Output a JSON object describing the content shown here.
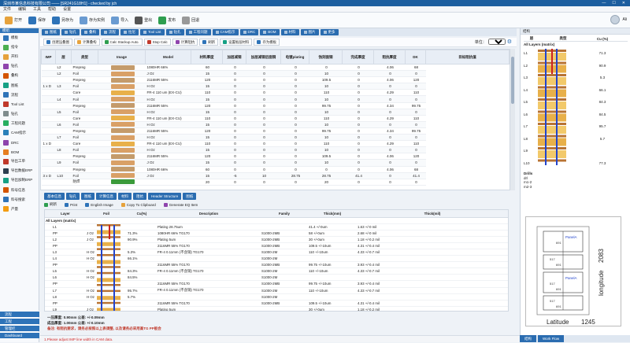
{
  "app": {
    "title": "深圳市某信息科技有限公司 —— [SR241G18H1] - checked by jch",
    "window_buttons": [
      "—",
      "☐",
      "✕"
    ],
    "user": "Ali"
  },
  "menu": [
    "文件",
    "编辑",
    "工具",
    "帮助",
    "设置"
  ],
  "toolbar": [
    {
      "label": "打开",
      "icon": "folder-icon",
      "color": "#e6a23c"
    },
    {
      "label": "保存",
      "icon": "save-icon",
      "color": "#2e73b8"
    },
    {
      "label": "另存为",
      "icon": "save-as-icon",
      "color": "#2e73b8"
    },
    {
      "label": "存为实例",
      "icon": "template-icon",
      "color": "#6a9bd1"
    },
    {
      "label": "导入",
      "icon": "import-icon",
      "color": "#6a9bd1"
    },
    {
      "label": "登出",
      "icon": "lock-icon",
      "color": "#555"
    },
    {
      "label": "发布",
      "icon": "publish-icon",
      "color": "#2e9e4f"
    },
    {
      "label": "回退",
      "icon": "undo-icon",
      "color": "#999"
    }
  ],
  "sidebar": {
    "header": "模组",
    "items": [
      {
        "label": "模板",
        "color": "#2e73b8"
      },
      {
        "label": "指令",
        "color": "#4caf50"
      },
      {
        "label": "开料",
        "color": "#e6a23c"
      },
      {
        "label": "钻孔",
        "color": "#8e44ad"
      },
      {
        "label": "叠构",
        "color": "#d35400"
      },
      {
        "label": "图纸",
        "color": "#16a085"
      },
      {
        "label": "流程",
        "color": "#2e73b8"
      },
      {
        "label": "Tool List",
        "color": "#c0392b"
      },
      {
        "label": "钻孔",
        "color": "#7f8c8d"
      },
      {
        "label": "工程问题",
        "color": "#27ae60"
      },
      {
        "label": "CAM指示",
        "color": "#2980b9"
      },
      {
        "label": "DRC",
        "color": "#8e44ad"
      },
      {
        "label": "BOM",
        "color": "#e67e22"
      },
      {
        "label": "导出工单",
        "color": "#c0392b"
      },
      {
        "label": "导出数据ERP",
        "color": "#2c3e50"
      },
      {
        "label": "导出加制ERP",
        "color": "#16a085"
      },
      {
        "label": "料号信息",
        "color": "#d35400"
      },
      {
        "label": "料号搜索",
        "color": "#2e73b8"
      },
      {
        "label": "产量",
        "color": "#f39c12"
      }
    ],
    "footer": [
      "流程",
      "工程",
      "管理栏",
      "Dashboard"
    ]
  },
  "tabs_top": [
    "图纸",
    "钻孔",
    "叠构",
    "流程",
    "拉尼",
    "Tool List",
    "钻孔",
    "工程问题",
    "CAM指示",
    "DRC",
    "BOM",
    "材料",
    "图片",
    "更多"
  ],
  "subtoolbar": {
    "buttons": [
      "创建压叠图",
      "计算叠构",
      "Calc Stackup Auto.",
      "Stop Calc",
      "计算阻抗",
      "刷新",
      "设置板层材料",
      "存为模板"
    ],
    "unit_label": "单位：",
    "unit_value": "Mil/OZ"
  },
  "stack_table": {
    "headers": [
      "IMP",
      "层",
      "类型",
      "Image",
      "Model",
      "材料厚度",
      "加层减铜",
      "加层减铜后面铜",
      "电镀plating",
      "蚀刻面铜",
      "完成厚度",
      "阻抗厚度",
      "DK",
      "目标阻抗值"
    ],
    "rows": [
      {
        "imp": "",
        "layer": "L2",
        "type": "Prepreg",
        "model": "1080HR 66%",
        "v": [
          "60",
          "0",
          "0",
          "0",
          "0",
          "0",
          "4.06",
          "68"
        ],
        "vc": "#c49b6b"
      },
      {
        "imp": "",
        "layer": "L2",
        "type": "Foil",
        "model": "J Oz",
        "v": [
          "15",
          "0",
          "0",
          "0",
          "10",
          "0",
          "0",
          "0"
        ],
        "vc": "#d9a066"
      },
      {
        "imp": "",
        "layer": "",
        "type": "Prepreg",
        "model": "2116MR 55%",
        "v": [
          "120",
          "0",
          "0",
          "0",
          "109.5",
          "0",
          "4.06",
          "120"
        ],
        "vc": "#c49b6b"
      },
      {
        "imp": "1 x D",
        "layer": "L3",
        "type": "Foil",
        "model": "H Oz",
        "v": [
          "15",
          "0",
          "0",
          "0",
          "10",
          "0",
          "0",
          "0"
        ],
        "vc": "#d9a066"
      },
      {
        "imp": "",
        "layer": "",
        "type": "Core",
        "model": "FR-4 110 um (EX-CU)",
        "v": [
          "110",
          "0",
          "0",
          "0",
          "110",
          "0",
          "4.29",
          "110"
        ],
        "vc": "#e8b04a"
      },
      {
        "imp": "",
        "layer": "L4",
        "type": "Foil",
        "model": "H Oz",
        "v": [
          "15",
          "0",
          "0",
          "0",
          "10",
          "0",
          "0",
          "0"
        ],
        "vc": "#d9a066"
      },
      {
        "imp": "",
        "layer": "",
        "type": "Prepreg",
        "model": "2116MR 55%",
        "v": [
          "120",
          "0",
          "0",
          "0",
          "99.75",
          "0",
          "4.34",
          "99.75"
        ],
        "vc": "#c49b6b"
      },
      {
        "imp": "",
        "layer": "L5",
        "type": "Foil",
        "model": "H Oz",
        "v": [
          "15",
          "0",
          "0",
          "0",
          "10",
          "0",
          "0",
          "0"
        ],
        "vc": "#d9a066"
      },
      {
        "imp": "",
        "layer": "",
        "type": "Core",
        "model": "FR-4 110 um (EX-CU)",
        "v": [
          "110",
          "0",
          "0",
          "0",
          "110",
          "0",
          "4.29",
          "110"
        ],
        "vc": "#e8b04a"
      },
      {
        "imp": "",
        "layer": "L6",
        "type": "Foil",
        "model": "H Oz",
        "v": [
          "15",
          "0",
          "0",
          "0",
          "10",
          "0",
          "0",
          "0"
        ],
        "vc": "#d9a066"
      },
      {
        "imp": "",
        "layer": "",
        "type": "Prepreg",
        "model": "2116MR 55%",
        "v": [
          "120",
          "0",
          "0",
          "0",
          "99.75",
          "0",
          "4.34",
          "99.75"
        ],
        "vc": "#c49b6b"
      },
      {
        "imp": "",
        "layer": "L7",
        "type": "Foil",
        "model": "H Oz",
        "v": [
          "15",
          "0",
          "0",
          "0",
          "10",
          "0",
          "0",
          "0"
        ],
        "vc": "#d9a066"
      },
      {
        "imp": "1 x D",
        "layer": "",
        "type": "Core",
        "model": "FR-4 110 um (EX-CU)",
        "v": [
          "110",
          "0",
          "0",
          "0",
          "110",
          "0",
          "4.29",
          "110"
        ],
        "vc": "#e8b04a"
      },
      {
        "imp": "",
        "layer": "L8",
        "type": "Foil",
        "model": "H Oz",
        "v": [
          "15",
          "0",
          "0",
          "0",
          "10",
          "0",
          "0",
          "0"
        ],
        "vc": "#d9a066"
      },
      {
        "imp": "",
        "layer": "",
        "type": "Prepreg",
        "model": "2116MR 55%",
        "v": [
          "120",
          "0",
          "0",
          "0",
          "109.5",
          "0",
          "4.06",
          "120"
        ],
        "vc": "#c49b6b"
      },
      {
        "imp": "",
        "layer": "L9",
        "type": "Foil",
        "model": "J Oz",
        "v": [
          "15",
          "0",
          "0",
          "0",
          "10",
          "0",
          "0",
          "0"
        ],
        "vc": "#d9a066"
      },
      {
        "imp": "",
        "layer": "",
        "type": "Prepreg",
        "model": "1080HR 66%",
        "v": [
          "60",
          "0",
          "0",
          "0",
          "0",
          "0",
          "4.06",
          "68"
        ],
        "vc": "#c49b6b"
      },
      {
        "imp": "3 x D",
        "layer": "L10",
        "type": "Foil",
        "model": "J Oz",
        "v": [
          "15",
          "-5",
          "10",
          "28.75",
          "28.75",
          "41.4",
          "0",
          "41.4"
        ],
        "vc": "#d9a066"
      },
      {
        "imp": "",
        "layer": "",
        "type": "防焊",
        "model": "",
        "v": [
          "20",
          "0",
          "0",
          "0",
          "20",
          "0",
          "0",
          "0"
        ],
        "vc": "#3a9a3a"
      }
    ]
  },
  "tabs_bottom": [
    "基本信息",
    "钻孔",
    "图纸",
    "计算信息",
    "材料",
    "阻抗",
    "Header Structure",
    "图纸"
  ],
  "bottom_toolbar": [
    "刷新",
    "Print",
    "English Image",
    "Copy To Clipboard",
    "Generate EQ Item"
  ],
  "spec_table": {
    "headers": [
      "Layer",
      "Foil",
      "Cu(%)",
      "Description",
      "Family",
      "Thick(mm)",
      "Thick(mil)"
    ],
    "section": "All Layers (matrix)",
    "rows": [
      {
        "layer": "L1",
        "foil": "",
        "cu": "",
        "desc": "Plating 28.75um",
        "family": "",
        "mm": "41.4 +/-0um",
        "mil": "1.63 +/-0 mil"
      },
      {
        "layer": "PP",
        "foil": "J Oz",
        "cu": "71.3%",
        "desc": "1080HR 66% TG170",
        "family": "S1000-2MB",
        "mm": "58 +/-0um",
        "mil": "2.68 +/-0 mil"
      },
      {
        "layer": "L2",
        "foil": "J Oz",
        "cu": "90.9%",
        "desc": "Plating 5um",
        "family": "S1000-2MB",
        "mm": "30 +/-0um",
        "mil": "1.18 +/-0.2 mil"
      },
      {
        "layer": "PP",
        "foil": "",
        "cu": "",
        "desc": "2116MR 55% TG170",
        "family": "S1000-2MB",
        "mm": "109.5 +/-10um",
        "mil": "4.31 +/-0.4 mil"
      },
      {
        "layer": "L3",
        "foil": "H Oz",
        "cu": "5.3%",
        "desc": "FR-4 0.11mm (不含铜) TG170",
        "family": "S1000-2M",
        "mm": "110 +/-10um",
        "mil": "4.33 +/-0.7 mil"
      },
      {
        "layer": "L4",
        "foil": "H Oz",
        "cu": "66.1%",
        "desc": "",
        "family": "S1000-2M",
        "mm": "",
        "mil": ""
      },
      {
        "layer": "PP",
        "foil": "",
        "cu": "",
        "desc": "2116MR 55% TG170",
        "family": "S1000-2MB",
        "mm": "99.75 +/-10um",
        "mil": "3.93 +/-0.4 mil"
      },
      {
        "layer": "L5",
        "foil": "H Oz",
        "cu": "84.3%",
        "desc": "FR-4 0.11mm (不含铜) TG170",
        "family": "S1000-2M",
        "mm": "110 +/-10um",
        "mil": "4.33 +/-0.7 mil"
      },
      {
        "layer": "L6",
        "foil": "H Oz",
        "cu": "84.5%",
        "desc": "",
        "family": "S1000-2M",
        "mm": "",
        "mil": ""
      },
      {
        "layer": "PP",
        "foil": "",
        "cu": "",
        "desc": "2116MR 55% TG170",
        "family": "S1000-2MB",
        "mm": "99.75 +/-10um",
        "mil": "3.93 +/-0.4 mil"
      },
      {
        "layer": "L7",
        "foil": "H Oz",
        "cu": "95.7%",
        "desc": "FR-4 0.11mm (不含铜) TG170",
        "family": "S1000-2M",
        "mm": "110 +/-10um",
        "mil": "4.33 +/-0.7 mil"
      },
      {
        "layer": "L8",
        "foil": "H Oz",
        "cu": "5.7%",
        "desc": "",
        "family": "S1000-2M",
        "mm": "",
        "mil": ""
      },
      {
        "layer": "PP",
        "foil": "",
        "cu": "",
        "desc": "2116MR 55% TG170",
        "family": "S1000-2MB",
        "mm": "109.5 +/-10um",
        "mil": "4.31 +/-0.4 mil"
      },
      {
        "layer": "L9",
        "foil": "J Oz",
        "cu": "",
        "desc": "Plating 5um",
        "family": "",
        "mm": "30 +/-0um",
        "mil": "1.18 +/-0.2 mil"
      },
      {
        "layer": "PP",
        "foil": "J Oz",
        "cu": "",
        "desc": "1080HR 66% TG170",
        "family": "S1000-2MB",
        "mm": "58 +/-0um",
        "mil": "2.68 +/-0 mil"
      },
      {
        "layer": "L10",
        "foil": "J Oz",
        "cu": "77.3%",
        "desc": "Plating 28.75um",
        "family": "",
        "mm": "41.4 +/-0um",
        "mil": "1.63 +/-0 mil"
      }
    ]
  },
  "notes": [
    "一压厚度: 0.90mm 公差: +/-0.09mm",
    "成品厚度: 1.00mm 公差: +/-0.10mm",
    "备注: 有阻抗要求，请务必按照以上表调整, 以及请务必采用高TG PP板会"
  ],
  "status": "1.Please adjust IMP line width in CAM data.",
  "right_panel": {
    "title": "结构",
    "headers": [
      "层",
      "类型",
      "Cu (%)"
    ],
    "section": "All Layers (matrix)",
    "rows": [
      {
        "l": "L1",
        "cu": "71.3"
      },
      {
        "l": "L2",
        "cu": "90.9"
      },
      {
        "l": "L3",
        "cu": "5.3"
      },
      {
        "l": "L4",
        "cu": "66.1"
      },
      {
        "l": "L5",
        "cu": "84.3"
      },
      {
        "l": "L6",
        "cu": "84.5"
      },
      {
        "l": "L7",
        "cu": "95.7"
      },
      {
        "l": "L8",
        "cu": "5.7"
      },
      {
        "l": "L9",
        "cu": ""
      },
      {
        "l": "L10",
        "cu": "77.3"
      }
    ],
    "drills_label": "Drills",
    "drills": [
      "drl",
      "m1-2",
      "m2-3"
    ],
    "tabs": [
      "结构",
      "Work Flow"
    ]
  },
  "panel": {
    "label_latitude": "Latitude",
    "latitude": "1245",
    "label_longitude": "longitude",
    "longitude": "2083",
    "dims": [
      "691",
      "517",
      "691",
      "517",
      "691",
      "517",
      "691"
    ],
    "panel_tag": "PanelA"
  }
}
